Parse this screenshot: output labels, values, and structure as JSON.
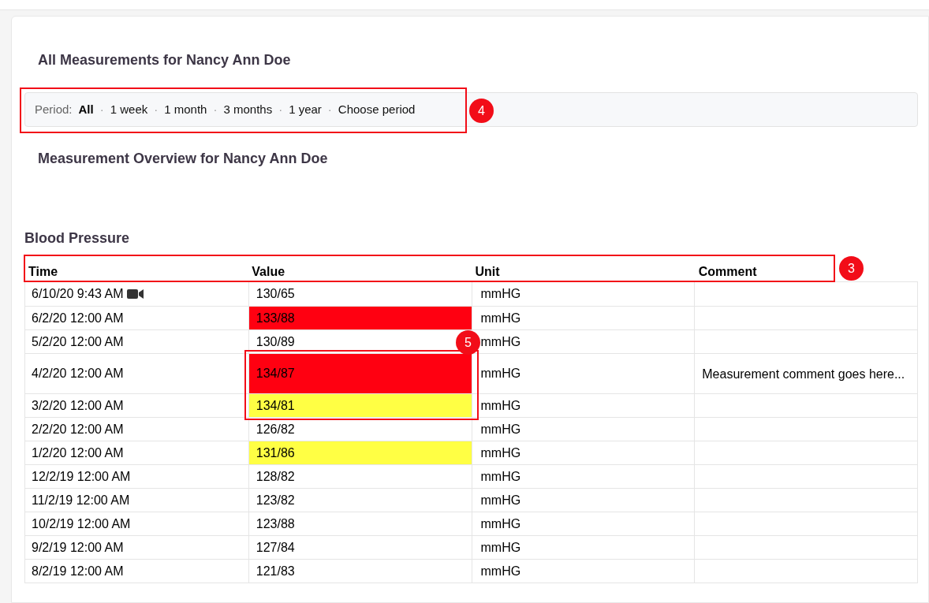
{
  "title": "All Measurements for Nancy Ann Doe",
  "period": {
    "label": "Period:",
    "separator": "·",
    "options": [
      {
        "label": "All",
        "selected": true
      },
      {
        "label": "1 week",
        "selected": false
      },
      {
        "label": "1 month",
        "selected": false
      },
      {
        "label": "3 months",
        "selected": false
      },
      {
        "label": "1 year",
        "selected": false
      },
      {
        "label": "Choose period",
        "selected": false
      }
    ]
  },
  "overview_title": "Measurement Overview for Nancy Ann Doe",
  "section_title": "Blood Pressure",
  "table": {
    "columns": [
      "Time",
      "Value",
      "Unit",
      "Comment"
    ],
    "rows": [
      {
        "time": "6/10/20 9:43 AM",
        "video": true,
        "value": "130/65",
        "unit": "mmHG"
      },
      {
        "time": "6/2/20 12:00 AM",
        "video": false,
        "value": "133/88",
        "color": "#ff0011",
        "unit": "mmHG"
      },
      {
        "time": "5/2/20 12:00 AM",
        "video": false,
        "value": "130/89",
        "unit": "mmHG"
      },
      {
        "time": "4/2/20 12:00 AM",
        "video": false,
        "value": "134/87",
        "color": "#ff0011",
        "unit": "mmHG",
        "comment": "Measurement comment goes here..."
      },
      {
        "time": "3/2/20 12:00 AM",
        "video": false,
        "value": "134/81",
        "color": "#ffff44",
        "unit": "mmHG"
      },
      {
        "time": "2/2/20 12:00 AM",
        "video": false,
        "value": "126/82",
        "unit": "mmHG"
      },
      {
        "time": "1/2/20 12:00 AM",
        "video": false,
        "value": "131/86",
        "color": "#ffff44",
        "unit": "mmHG"
      },
      {
        "time": "12/2/19 12:00 AM",
        "video": false,
        "value": "128/82",
        "unit": "mmHG"
      },
      {
        "time": "11/2/19 12:00 AM",
        "video": false,
        "value": "123/82",
        "unit": "mmHG"
      },
      {
        "time": "10/2/19 12:00 AM",
        "video": false,
        "value": "123/88",
        "unit": "mmHG"
      },
      {
        "time": "9/2/19 12:00 AM",
        "video": false,
        "value": "127/84",
        "unit": "mmHG"
      },
      {
        "time": "8/2/19 12:00 AM",
        "video": false,
        "value": "121/83",
        "unit": "mmHG"
      }
    ]
  },
  "annotations": [
    {
      "number": "4"
    },
    {
      "number": "3"
    },
    {
      "number": "5"
    }
  ]
}
